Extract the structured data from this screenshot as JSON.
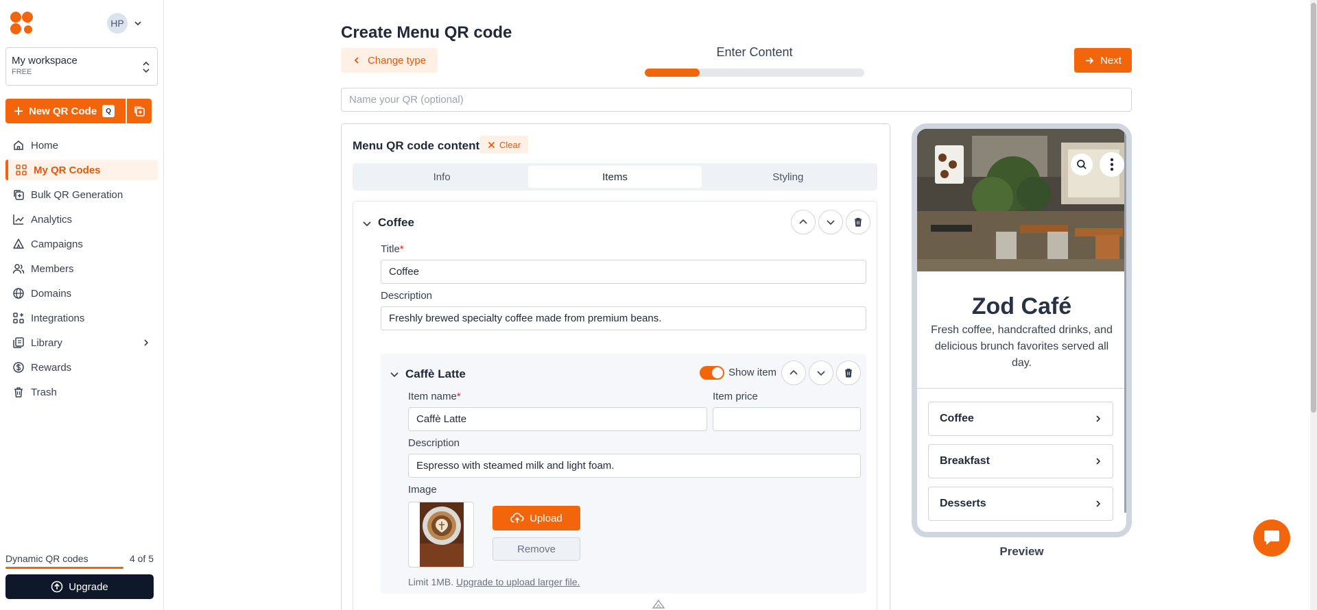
{
  "sidebar": {
    "avatar": "HP",
    "workspace": {
      "name": "My workspace",
      "plan": "FREE"
    },
    "new_qr_label": "New QR Code",
    "new_qr_shortcut": "Q",
    "nav": [
      {
        "label": "Home",
        "icon": "home-icon"
      },
      {
        "label": "My QR Codes",
        "icon": "qr-grid-icon",
        "active": true
      },
      {
        "label": "Bulk QR Generation",
        "icon": "bulk-copy-icon"
      },
      {
        "label": "Analytics",
        "icon": "analytics-icon"
      },
      {
        "label": "Campaigns",
        "icon": "campaign-icon"
      },
      {
        "label": "Members",
        "icon": "members-icon"
      },
      {
        "label": "Domains",
        "icon": "globe-icon"
      },
      {
        "label": "Integrations",
        "icon": "integrations-icon"
      },
      {
        "label": "Library",
        "icon": "library-icon"
      },
      {
        "label": "Rewards",
        "icon": "dollar-icon"
      },
      {
        "label": "Trash",
        "icon": "trash-icon"
      }
    ],
    "usage_label": "Dynamic QR codes",
    "usage_count": "4 of 5",
    "upgrade_label": "Upgrade"
  },
  "header": {
    "title": "Create Menu QR code",
    "change_type": "Change type",
    "step_label": "Enter Content",
    "step_progress": 0.25,
    "next": "Next",
    "name_placeholder": "Name your QR (optional)"
  },
  "content": {
    "title": "Menu QR code content",
    "clear": "Clear",
    "tabs": [
      "Info",
      "Items",
      "Styling"
    ],
    "active_tab": "Items",
    "section": {
      "name": "Coffee",
      "title_label": "Title",
      "title_value": "Coffee",
      "desc_label": "Description",
      "desc_value": "Freshly brewed specialty coffee made from premium beans.",
      "item": {
        "name": "Caffè Latte",
        "show_label": "Show item",
        "name_label": "Item name",
        "name_value": "Caffè Latte",
        "price_label": "Item price",
        "price_value": "",
        "desc_label": "Description",
        "desc_value": "Espresso with steamed milk and light foam.",
        "image_label": "Image",
        "upload": "Upload",
        "remove": "Remove",
        "limit_text": "Limit 1MB.",
        "limit_link": "Upgrade to upload larger file."
      }
    }
  },
  "preview": {
    "cafe_name": "Zod Café",
    "cafe_desc": "Fresh coffee, handcrafted drinks, and delicious brunch favorites served all day.",
    "menu": [
      "Coffee",
      "Breakfast",
      "Desserts"
    ],
    "label": "Preview"
  },
  "colors": {
    "accent": "#f2650a",
    "dark": "#0f172a",
    "accent_soft": "#fff0e6"
  }
}
